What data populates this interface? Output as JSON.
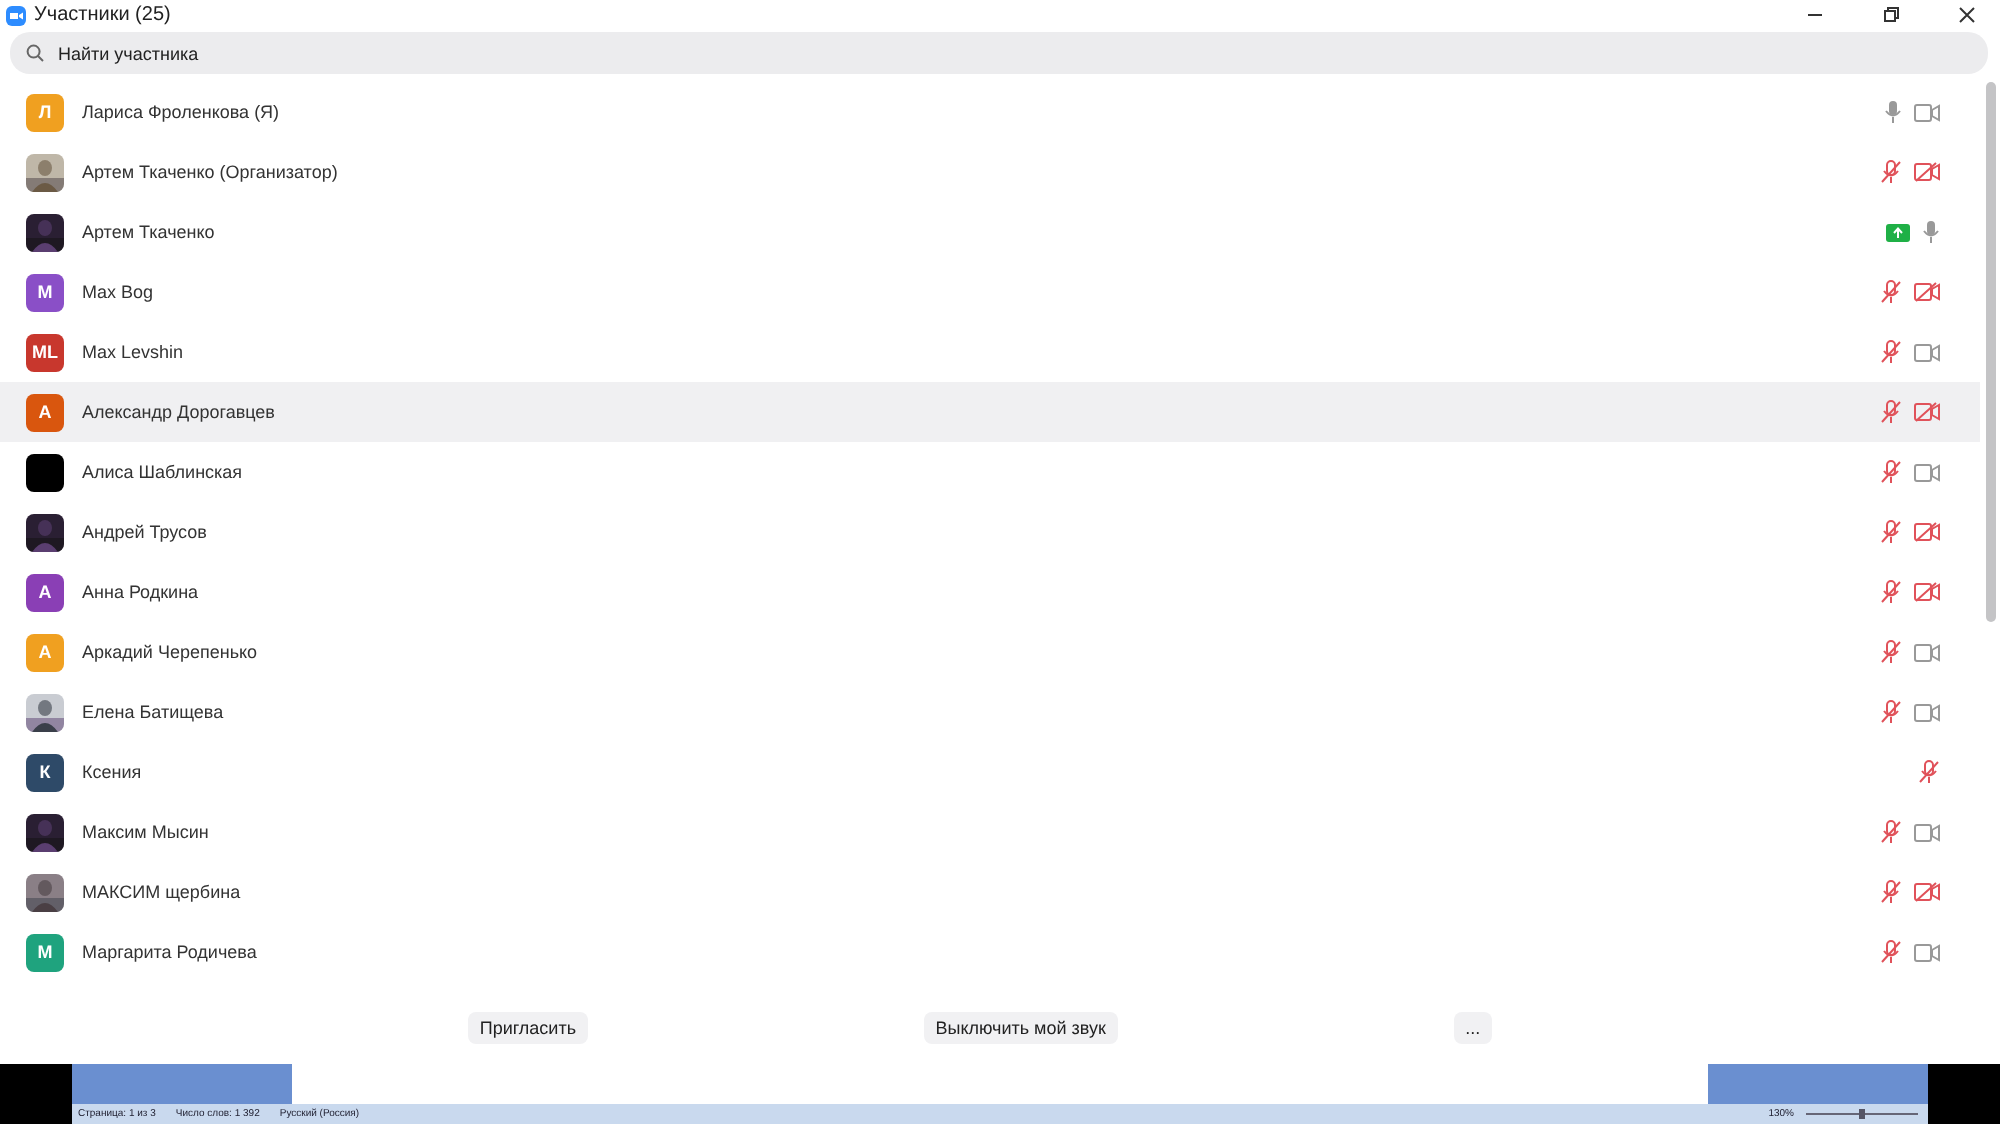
{
  "window": {
    "title": "Участники (25)"
  },
  "search": {
    "placeholder": "Найти участника"
  },
  "participants": [
    {
      "name": "Лариса Фроленкова (Я)",
      "avatar": {
        "kind": "letter",
        "text": "Л",
        "color": "#f0a020"
      },
      "icons": [
        {
          "kind": "mic",
          "off": false
        },
        {
          "kind": "camera",
          "off": false
        }
      ],
      "highlighted": false
    },
    {
      "name": "Артем Ткаченко (Организатор)",
      "avatar": {
        "kind": "picture"
      },
      "icons": [
        {
          "kind": "mic",
          "off": true
        },
        {
          "kind": "camera",
          "off": true
        }
      ],
      "highlighted": false
    },
    {
      "name": "Артем Ткаченко",
      "avatar": {
        "kind": "picture"
      },
      "icons": [
        {
          "kind": "share"
        },
        {
          "kind": "mic",
          "off": false
        }
      ],
      "highlighted": false
    },
    {
      "name": "Max Bog",
      "avatar": {
        "kind": "letter",
        "text": "M",
        "color": "#8a4fc7"
      },
      "icons": [
        {
          "kind": "mic",
          "off": true
        },
        {
          "kind": "camera",
          "off": true
        }
      ],
      "highlighted": false
    },
    {
      "name": "Max Levshin",
      "avatar": {
        "kind": "letter",
        "text": "ML",
        "color": "#c8372d"
      },
      "icons": [
        {
          "kind": "mic",
          "off": true
        },
        {
          "kind": "camera",
          "off": false
        }
      ],
      "highlighted": false
    },
    {
      "name": "Александр Дорогавцев",
      "avatar": {
        "kind": "letter",
        "text": "А",
        "color": "#d9560e"
      },
      "icons": [
        {
          "kind": "mic",
          "off": true
        },
        {
          "kind": "camera",
          "off": true
        }
      ],
      "highlighted": true
    },
    {
      "name": "Алиса Шаблинская",
      "avatar": {
        "kind": "letter",
        "color": "#000000"
      },
      "icons": [
        {
          "kind": "mic",
          "off": true
        },
        {
          "kind": "camera",
          "off": false
        }
      ],
      "highlighted": false
    },
    {
      "name": "Андрей Трусов",
      "avatar": {
        "kind": "picture"
      },
      "icons": [
        {
          "kind": "mic",
          "off": true
        },
        {
          "kind": "camera",
          "off": true
        }
      ],
      "highlighted": false
    },
    {
      "name": "Анна Родкина",
      "avatar": {
        "kind": "letter",
        "text": "А",
        "color": "#8a3fb5"
      },
      "icons": [
        {
          "kind": "mic",
          "off": true
        },
        {
          "kind": "camera",
          "off": true
        }
      ],
      "highlighted": false
    },
    {
      "name": "Аркадий Черепенько",
      "avatar": {
        "kind": "letter",
        "text": "А",
        "color": "#f0a020"
      },
      "icons": [
        {
          "kind": "mic",
          "off": true
        },
        {
          "kind": "camera",
          "off": false
        }
      ],
      "highlighted": false
    },
    {
      "name": "Елена Батищева",
      "avatar": {
        "kind": "picture"
      },
      "icons": [
        {
          "kind": "mic",
          "off": true
        },
        {
          "kind": "camera",
          "off": false
        }
      ],
      "highlighted": false
    },
    {
      "name": "Ксения",
      "avatar": {
        "kind": "letter",
        "text": "К",
        "color": "#2e4a68"
      },
      "icons": [
        {
          "kind": "mic",
          "off": true
        }
      ],
      "highlighted": false
    },
    {
      "name": "Максим Мысин",
      "avatar": {
        "kind": "picture"
      },
      "icons": [
        {
          "kind": "mic",
          "off": true
        },
        {
          "kind": "camera",
          "off": false
        }
      ],
      "highlighted": false
    },
    {
      "name": "МАКСИМ щербина",
      "avatar": {
        "kind": "picture"
      },
      "icons": [
        {
          "kind": "mic",
          "off": true
        },
        {
          "kind": "camera",
          "off": true
        }
      ],
      "highlighted": false
    },
    {
      "name": "Маргарита Родичева",
      "avatar": {
        "kind": "letter",
        "text": "М",
        "color": "#1fa37e"
      },
      "icons": [
        {
          "kind": "mic",
          "off": true
        },
        {
          "kind": "camera",
          "off": false
        }
      ],
      "highlighted": false
    }
  ],
  "buttons": [
    "Пригласить",
    "Выключить мой звук",
    "..."
  ],
  "background_window": {
    "status_bar": [
      "Страница: 1 из 3",
      "Число слов: 1 392",
      "Русский (Россия)",
      "130%"
    ],
    "zoom_slider": {
      "level": 0.5
    }
  }
}
